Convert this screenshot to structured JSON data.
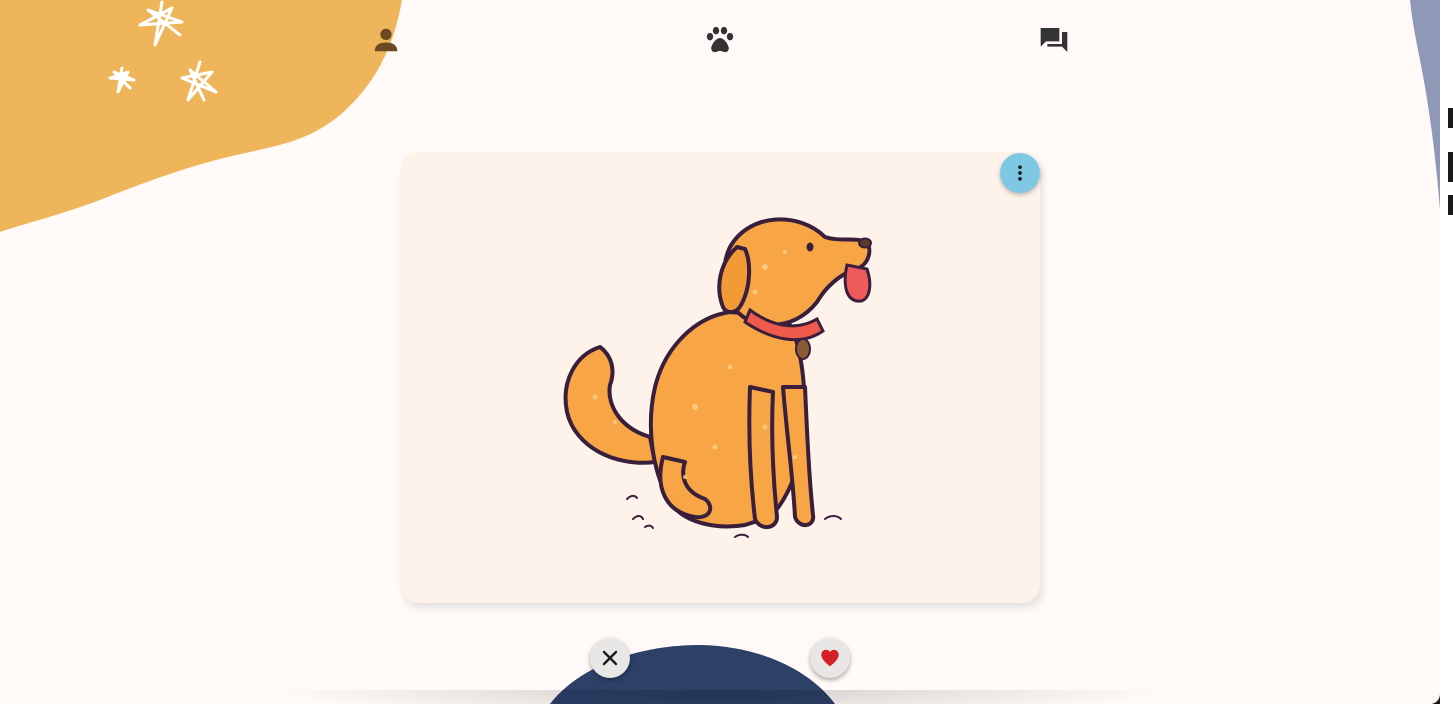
{
  "window": {
    "background": "#fffaf8"
  },
  "colors": {
    "blob_orange": "#efb55b",
    "blob_slate": "#8f98b7",
    "blob_navy": "#2c4068",
    "card_background": "#fdf3ea",
    "menu_button": "#7ec8e3",
    "like_heart": "#d42126",
    "nav_profile_icon": "#6b4a1f",
    "nav_icon": "#333333"
  },
  "nav": {
    "items": [
      {
        "icon": "person-icon",
        "active": true
      },
      {
        "icon": "paw-icon",
        "active": false
      },
      {
        "icon": "forum-icon",
        "active": false
      }
    ]
  },
  "card": {
    "image": "cartoon-dog-illustration",
    "menu_icon": "more-vert-icon"
  },
  "actions": {
    "dislike_icon": "close-icon",
    "like_icon": "heart-icon"
  }
}
